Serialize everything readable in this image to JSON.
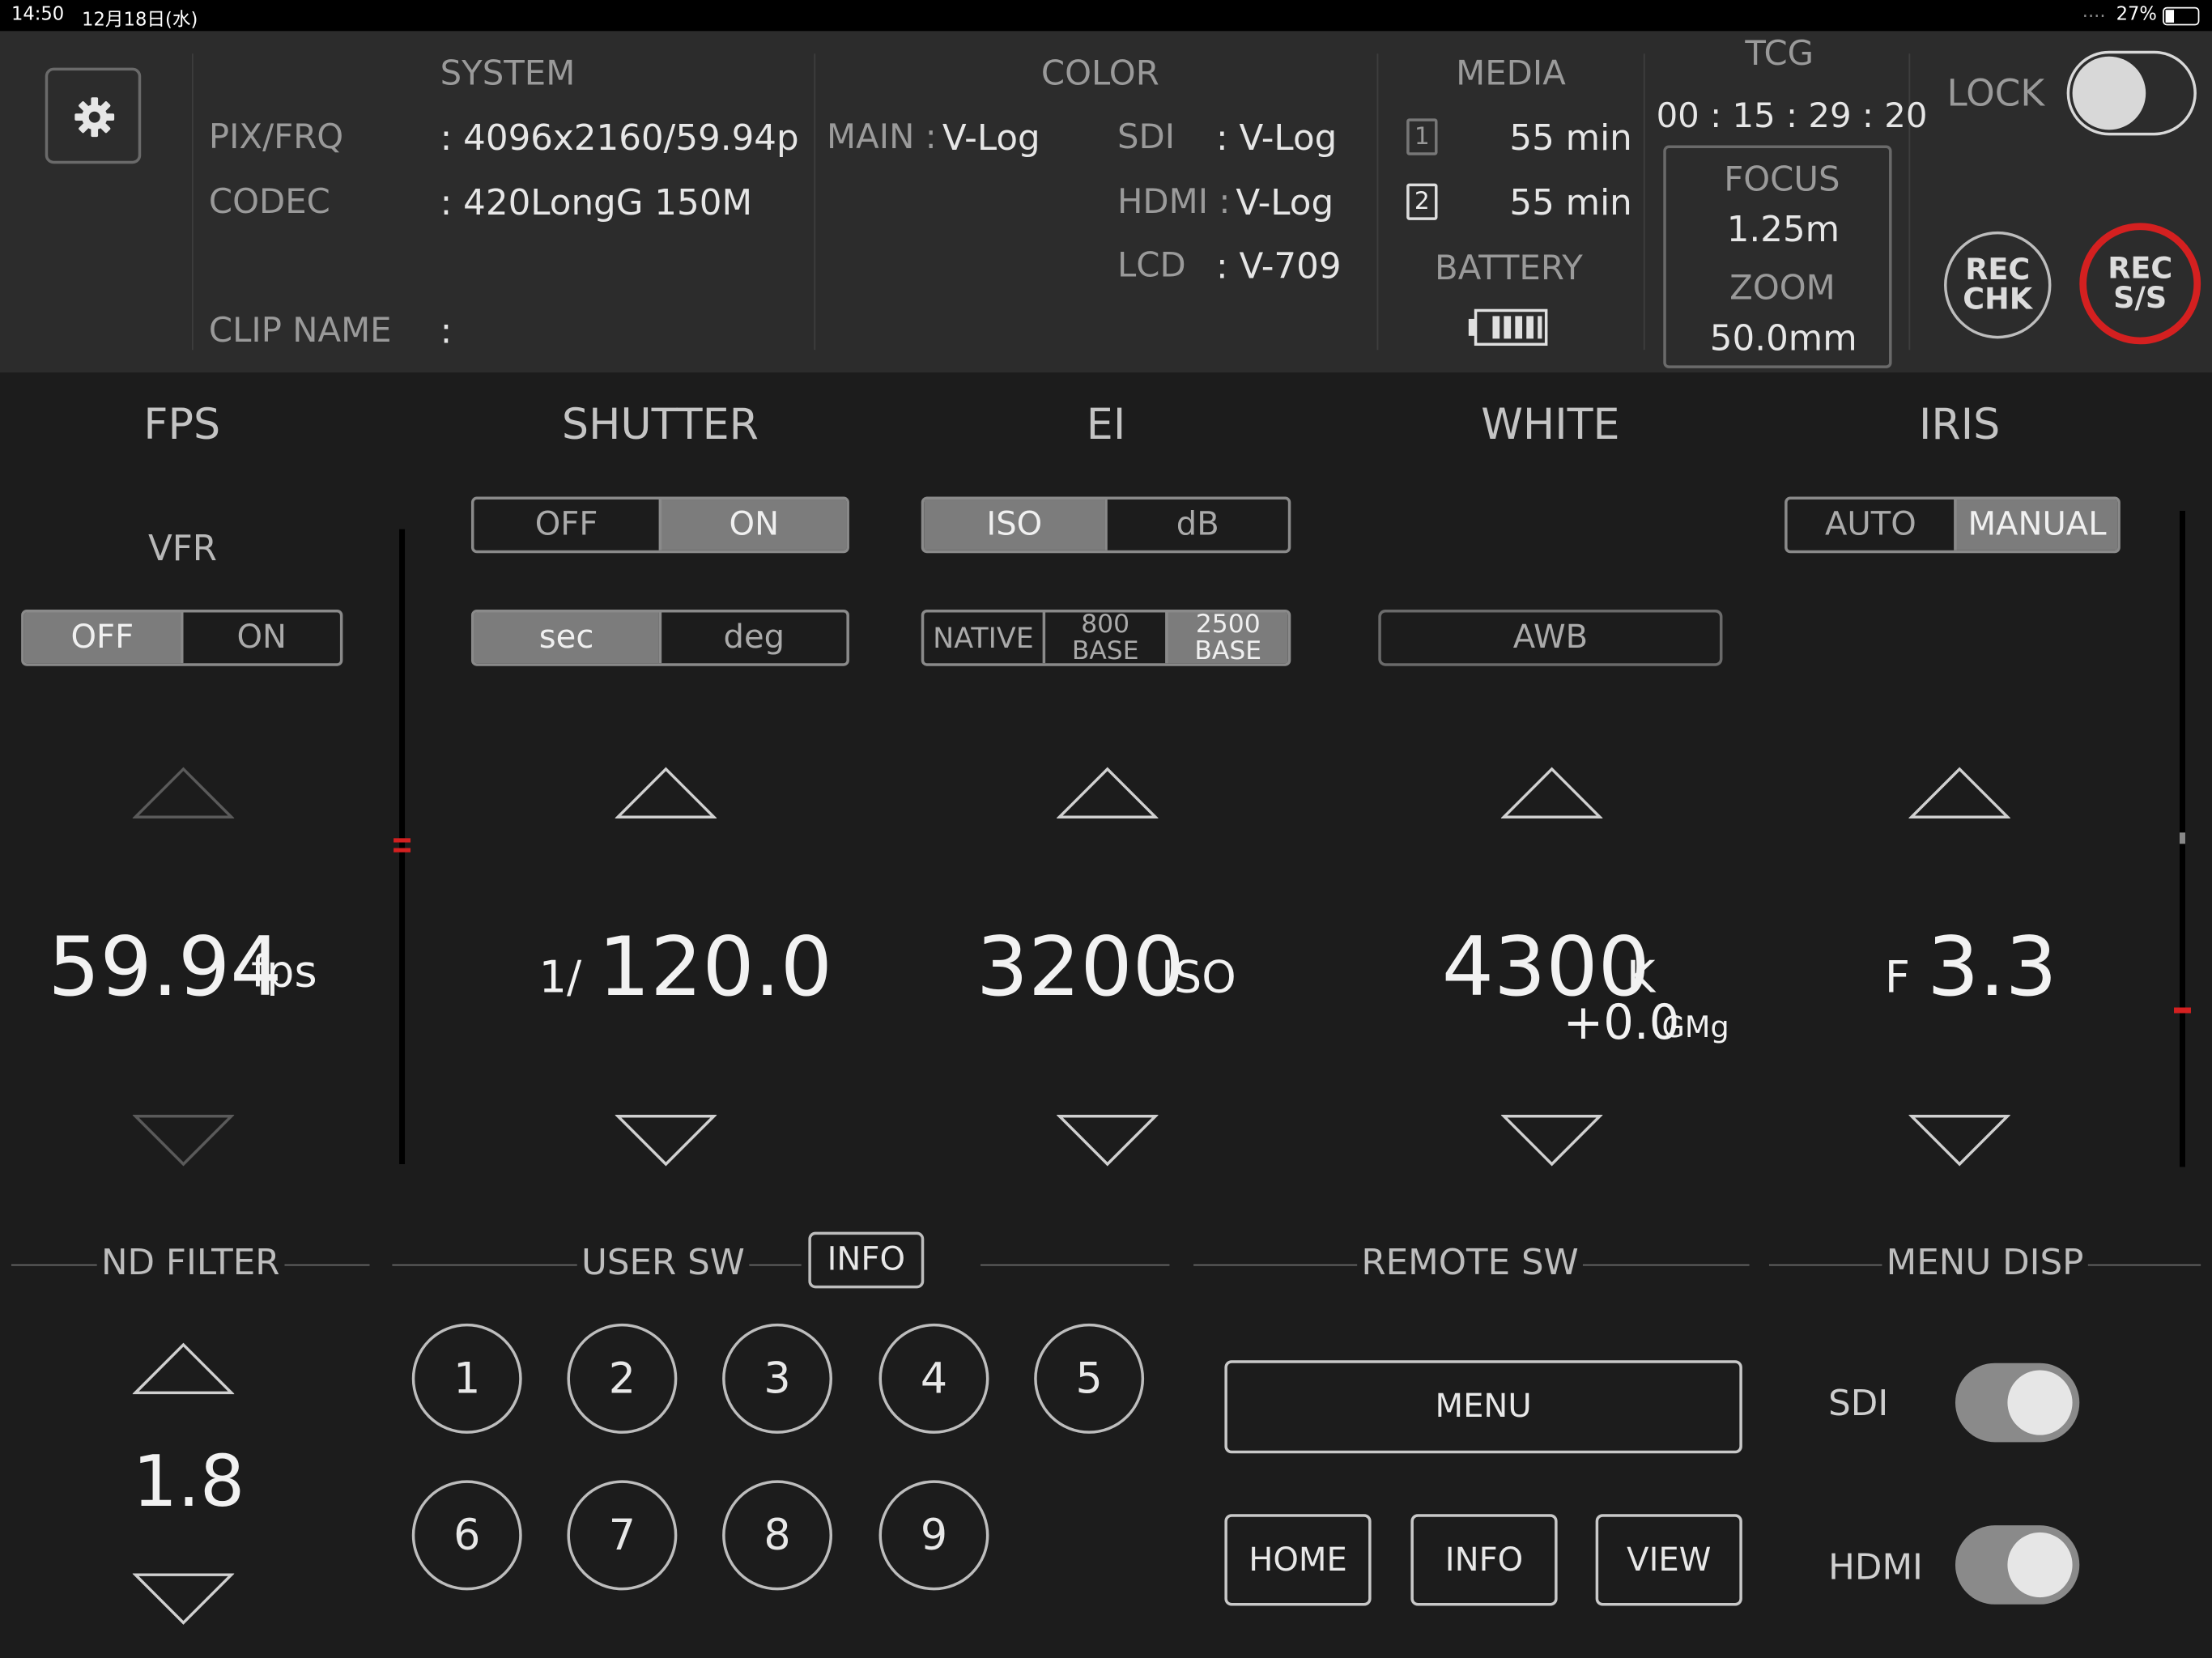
{
  "status_bar": {
    "time": "14:50",
    "date": "12月18日(水)",
    "battery": "27%"
  },
  "system": {
    "title": "SYSTEM",
    "pixfrq_label": "PIX/FRQ",
    "pixfrq_value": ": 4096x2160/59.94p",
    "codec_label": "CODEC",
    "codec_value": ": 420LongG 150M",
    "clip_label": "CLIP NAME",
    "clip_value": ":"
  },
  "color": {
    "title": "COLOR",
    "main_label": "MAIN :",
    "main_value": "V-Log",
    "sdi_label": "SDI",
    "sdi_value": ": V-Log",
    "hdmi_label": "HDMI :",
    "hdmi_value": "V-Log",
    "lcd_label": "LCD",
    "lcd_value": ": V-709"
  },
  "media": {
    "title": "MEDIA",
    "slot1_icon": "1",
    "slot1_value": "55 min",
    "slot2_icon": "2",
    "slot2_value": "55 min",
    "battery_label": "BATTERY"
  },
  "tcg": {
    "title": "TCG",
    "value": "00 : 15 : 29 : 20",
    "focus_label": "FOCUS",
    "focus_value": "1.25m",
    "zoom_label": "ZOOM",
    "zoom_value": "50.0mm"
  },
  "lock": {
    "label": "LOCK",
    "state": "off"
  },
  "rec_buttons": {
    "chk_line1": "REC",
    "chk_line2": "CHK",
    "ss_line1": "REC",
    "ss_line2": "S/S",
    "ss_color": "#d42020"
  },
  "fps": {
    "title": "FPS",
    "vfr_label": "VFR",
    "vfr_off": "OFF",
    "vfr_on": "ON",
    "value": "59.94",
    "unit": "fps"
  },
  "shutter": {
    "title": "SHUTTER",
    "off": "OFF",
    "on": "ON",
    "sec": "sec",
    "deg": "deg",
    "prefix": "1/",
    "value": "120.0"
  },
  "ei": {
    "title": "EI",
    "iso": "ISO",
    "db": "dB",
    "native": "NATIVE",
    "base800_1": "800",
    "base800_2": "BASE",
    "base2500_1": "2500",
    "base2500_2": "BASE",
    "value": "3200",
    "unit": "ISO"
  },
  "white": {
    "title": "WHITE",
    "awb": "AWB",
    "value": "4300",
    "unit": "K",
    "gmg_value": "+0.0",
    "gmg_unit": "GMg"
  },
  "iris": {
    "title": "IRIS",
    "auto": "AUTO",
    "manual": "MANUAL",
    "prefix": "F",
    "value": "3.3"
  },
  "nd_filter": {
    "title": "ND FILTER",
    "value": "1.8"
  },
  "user_sw": {
    "title": "USER SW",
    "info": "INFO",
    "buttons": [
      "1",
      "2",
      "3",
      "4",
      "5",
      "6",
      "7",
      "8",
      "9"
    ]
  },
  "remote_sw": {
    "title": "REMOTE SW",
    "menu": "MENU",
    "home": "HOME",
    "info": "INFO",
    "view": "VIEW"
  },
  "menu_disp": {
    "title": "MENU DISP",
    "sdi_label": "SDI",
    "hdmi_label": "HDMI",
    "sdi_state": "on",
    "hdmi_state": "on"
  },
  "accent_color": "#d42020"
}
